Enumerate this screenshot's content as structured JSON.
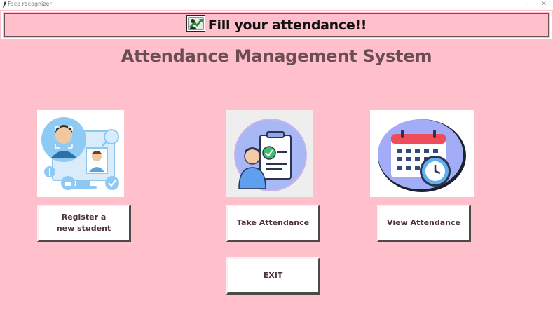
{
  "window": {
    "title": "Face recognizer",
    "minimize_glyph": "–",
    "close_glyph": "✕"
  },
  "banner": {
    "text": "Fill your attendance!!",
    "icon": "attendance-chart-icon"
  },
  "heading": "Attendance Management System",
  "cards": {
    "register": {
      "illustration": "face-recognition-illustration",
      "button_label": "Register a\n new student"
    },
    "take": {
      "illustration": "checklist-person-illustration",
      "button_label": "Take Attendance"
    },
    "view": {
      "illustration": "calendar-clock-illustration",
      "button_label": "View Attendance"
    }
  },
  "exit_button": {
    "label": "EXIT"
  },
  "colors": {
    "background": "#ffc0cb",
    "heading": "#6b4d55",
    "button_text": "#4d3338"
  }
}
